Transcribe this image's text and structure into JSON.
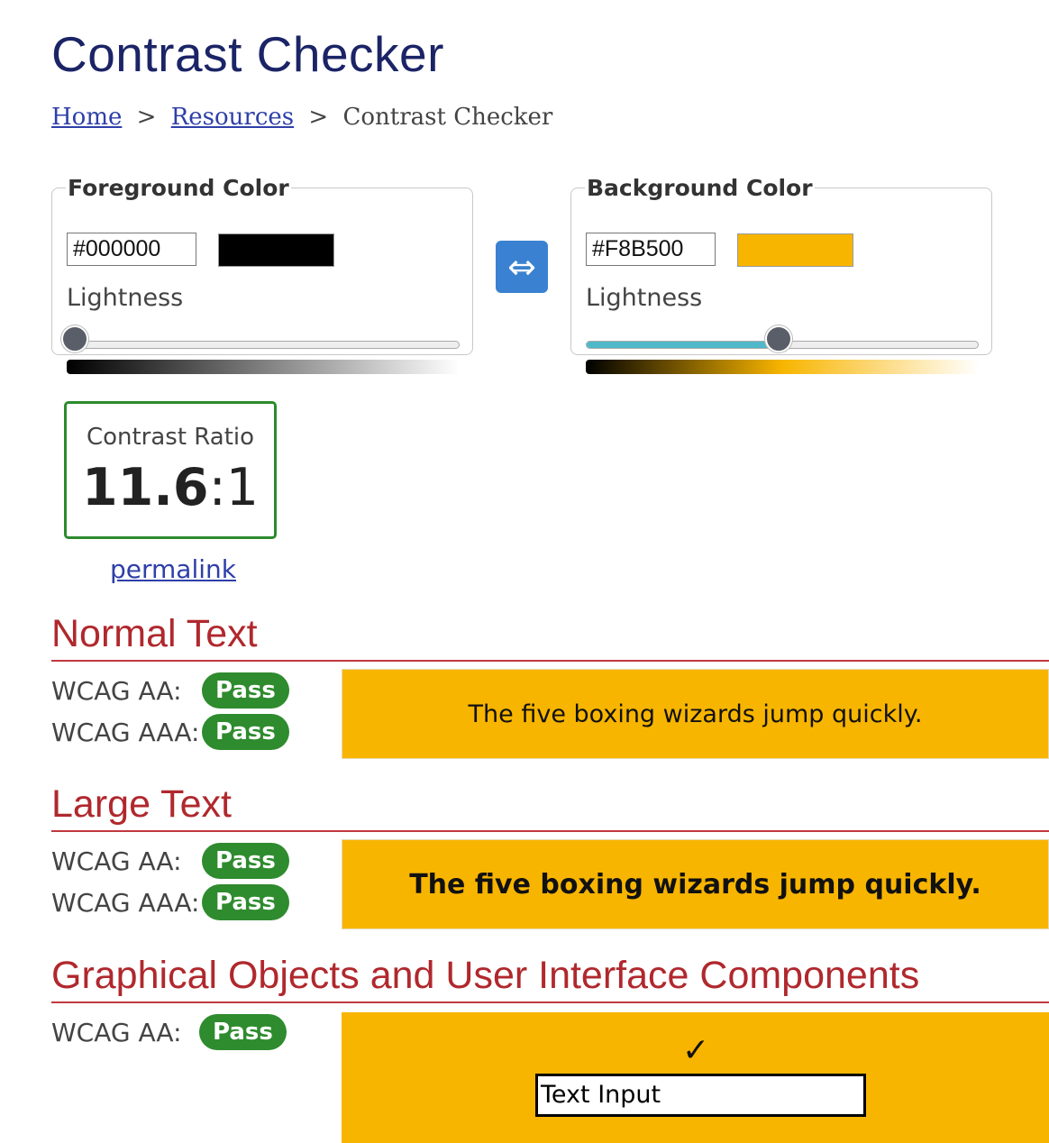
{
  "page": {
    "title": "Contrast Checker",
    "breadcrumb": {
      "home": "Home",
      "sep1": ">",
      "resources": "Resources",
      "sep2": ">",
      "current": "Contrast Checker"
    }
  },
  "foreground": {
    "legend": "Foreground Color",
    "hex": "#000000",
    "swatch_color": "#000000",
    "lightness_label": "Lightness",
    "lightness": 0.02
  },
  "background": {
    "legend": "Background Color",
    "hex": "#F8B500",
    "swatch_color": "#F8B500",
    "lightness_label": "Lightness",
    "lightness": 0.49
  },
  "swap": {
    "icon": "swap-horizontal-icon",
    "glyph": "⇔"
  },
  "result": {
    "label": "Contrast Ratio",
    "value": "11.6",
    "suffix": ":1",
    "permalink": "permalink"
  },
  "normal_text": {
    "heading": "Normal Text",
    "aa_label": "WCAG AA:",
    "aa_result": "Pass",
    "aaa_label": "WCAG AAA:",
    "aaa_result": "Pass",
    "sample": "The five boxing wizards jump quickly."
  },
  "large_text": {
    "heading": "Large Text",
    "aa_label": "WCAG AA:",
    "aa_result": "Pass",
    "aaa_label": "WCAG AAA:",
    "aaa_result": "Pass",
    "sample": "The five boxing wizards jump quickly."
  },
  "graphical": {
    "heading": "Graphical Objects and User Interface Components",
    "aa_label": "WCAG AA:",
    "aa_result": "Pass",
    "check_glyph": "✓",
    "input_value": "Text Input"
  },
  "colors": {
    "title": "#1b2466",
    "link": "#2e3fa8",
    "section_heading": "#b0282d",
    "pass": "#2e8b2e",
    "swap_button": "#3a82d1"
  }
}
